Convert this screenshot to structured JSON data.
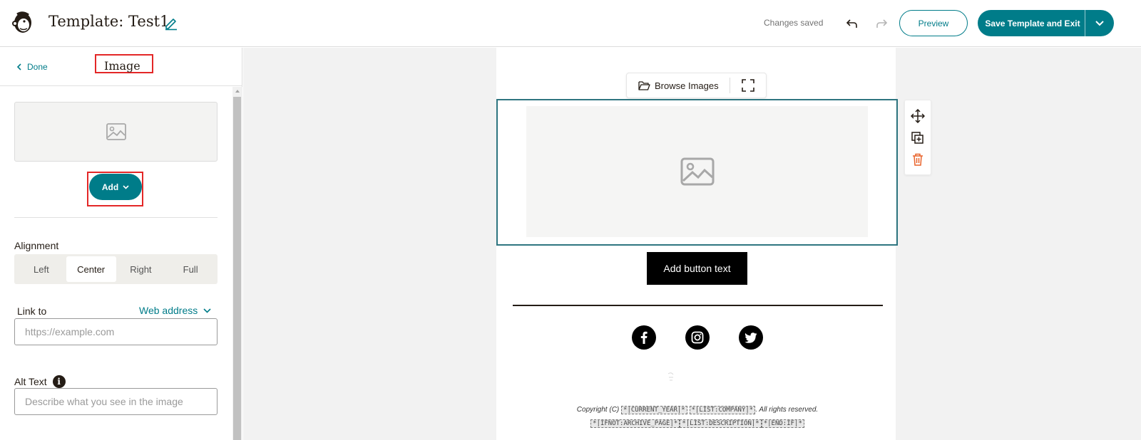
{
  "header": {
    "title": "Template: Test1",
    "status": "Changes saved",
    "preview_label": "Preview",
    "save_label": "Save Template and Exit"
  },
  "panel": {
    "done_label": "Done",
    "title": "Image",
    "add_label": "Add",
    "alignment_label": "Alignment",
    "alignment_options": [
      "Left",
      "Center",
      "Right",
      "Full"
    ],
    "alignment_selected": "Center",
    "link_label": "Link to",
    "link_type": "Web address",
    "url_placeholder": "https://example.com",
    "alt_label": "Alt Text",
    "alt_placeholder": "Describe what you see in the image"
  },
  "canvas": {
    "browse_label": "Browse Images",
    "button_text": "Add button text",
    "copyright_prefix": "Copyright (C)",
    "merge_year": "*|CURRENT_YEAR|*",
    "merge_company": "*|LIST:COMPANY|*",
    "rights_suffix": ". All rights reserved.",
    "merge_line": [
      "*|IFNOT:ARCHIVE_PAGE|*",
      "*|LIST:DESCRIPTION|*",
      "*|END:IF|*"
    ]
  },
  "colors": {
    "accent": "#007c89",
    "highlight_red": "#e32727",
    "delete_orange": "#e9632b"
  },
  "icons": [
    "mailchimp-logo-icon",
    "pencil-icon",
    "undo-icon",
    "redo-icon",
    "chevron-down-icon",
    "chevron-left-icon",
    "image-icon",
    "info-icon",
    "folder-icon",
    "fullscreen-icon",
    "move-icon",
    "duplicate-icon",
    "trash-icon",
    "facebook-icon",
    "instagram-icon",
    "twitter-icon"
  ]
}
